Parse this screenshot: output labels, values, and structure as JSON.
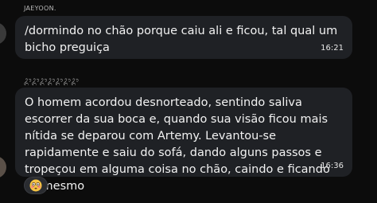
{
  "messages": [
    {
      "sender": "JAEYOON.",
      "text": "/dormindo no chão porque caiu ali e ficou, tal qual um bicho preguiça",
      "time": "16:21"
    },
    {
      "sender": "ᬊᬊᬊᬊᬊᬊᬊ",
      "text": "O homem acordou desnorteado, sentindo saliva escorrer da sua boca e, quando sua visão ficou mais nítida se deparou com Artemy. Levantou-se rapidamente e saiu do sofá, dando alguns passos e tropeçou em alguma coisa no chão, caindo e ficando ali mesmo",
      "time": "16:36",
      "reaction": "flushed-face-emoji"
    }
  ],
  "colors": {
    "background": "#0c0c0c",
    "bubble": "#1f2125",
    "text": "#f2f2f2",
    "sender": "#b8b8b8"
  }
}
